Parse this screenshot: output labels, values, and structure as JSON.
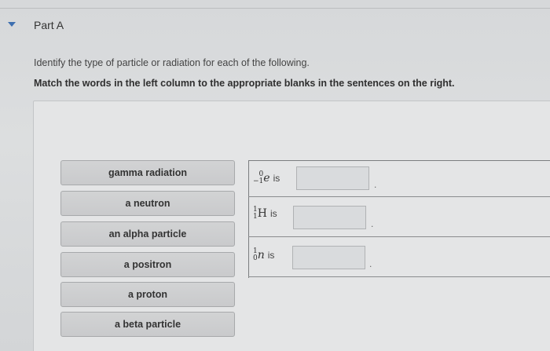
{
  "header": {
    "part_title": "Part A"
  },
  "instructions": {
    "line1": "Identify the type of particle or radiation for each of the following.",
    "line2": "Match the words in the left column to the appropriate blanks in the sentences on the right."
  },
  "drag_items": [
    "gamma radiation",
    "a neutron",
    "an alpha particle",
    "a positron",
    "a proton",
    "a beta particle"
  ],
  "sentences": [
    {
      "symbol": "e",
      "mass": "0",
      "atomic": "−1",
      "italic": true,
      "tail": "is"
    },
    {
      "symbol": "H",
      "mass": "1",
      "atomic": "1",
      "italic": false,
      "tail": "is"
    },
    {
      "symbol": "n",
      "mass": "1",
      "atomic": "0",
      "italic": true,
      "tail": "is"
    }
  ],
  "blank_terminator": "."
}
